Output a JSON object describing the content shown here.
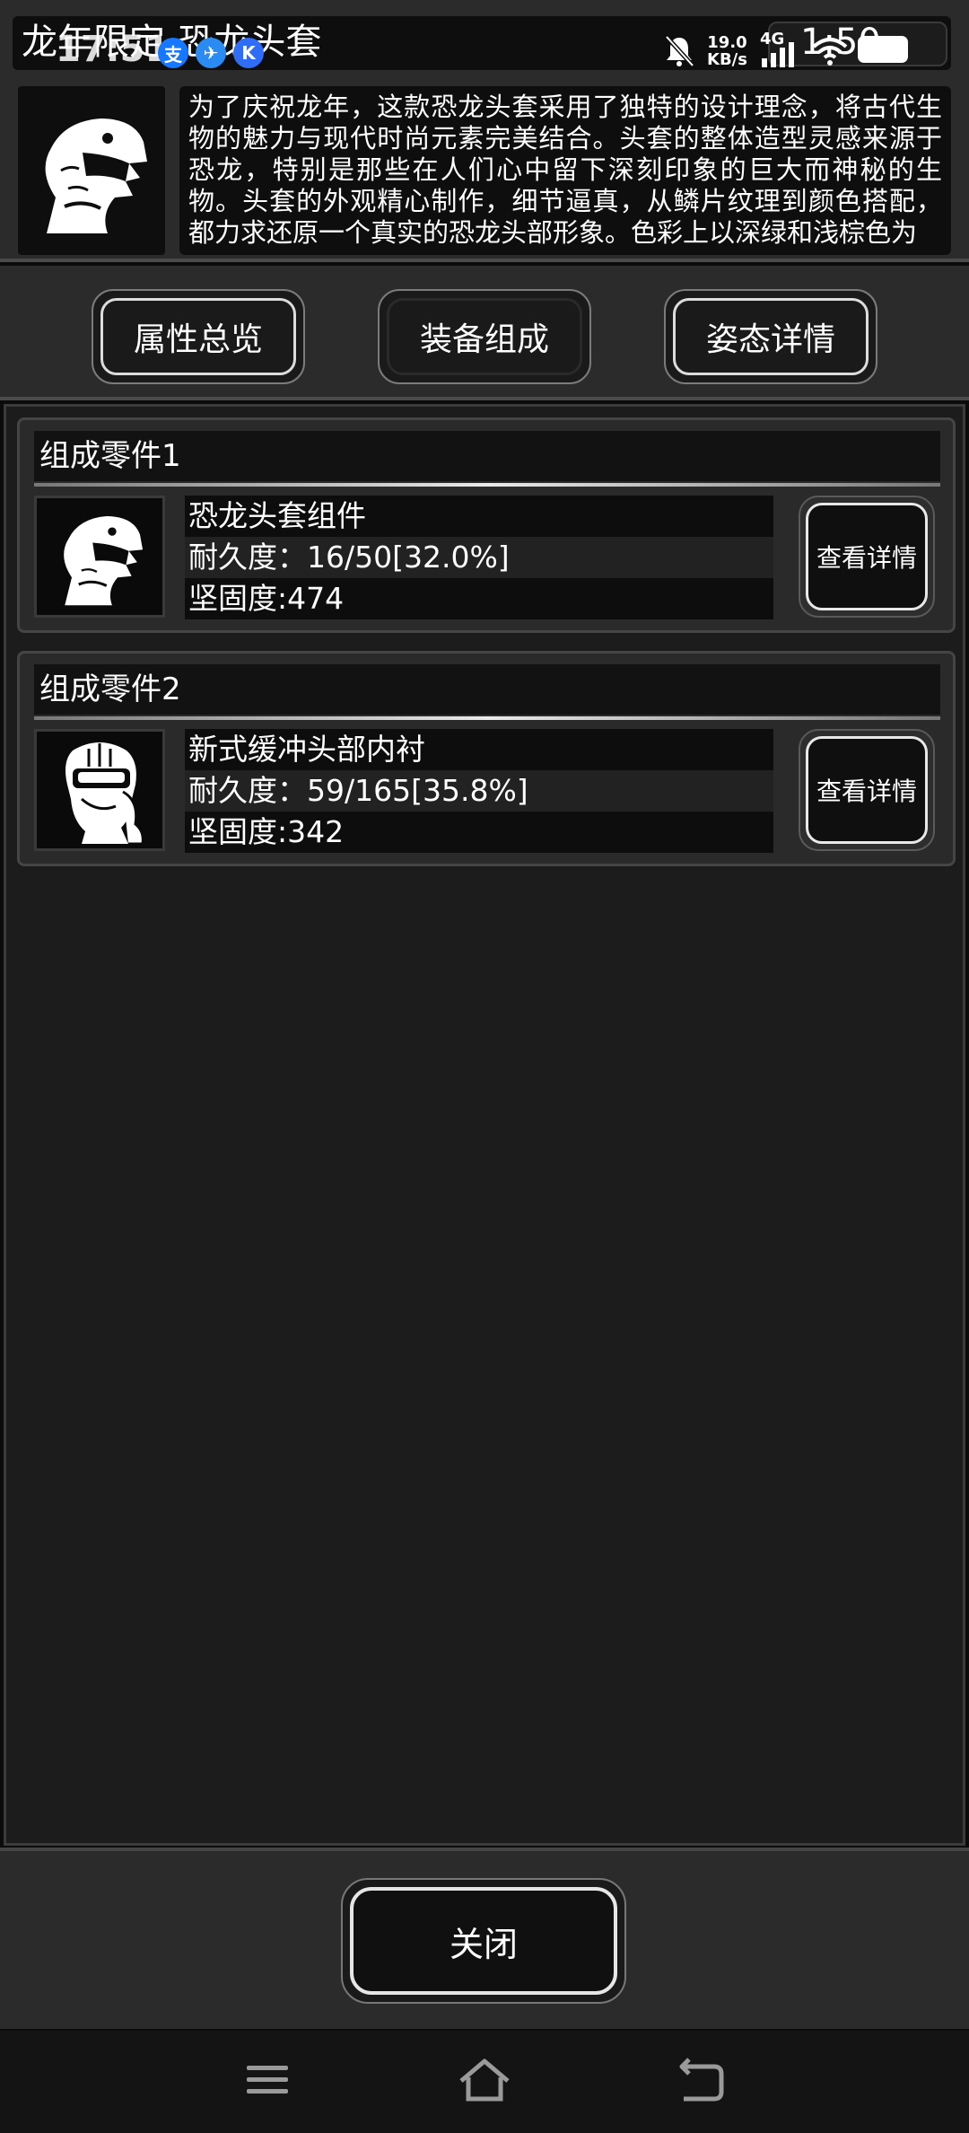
{
  "window": {
    "title": "龙年限定-恐龙头套"
  },
  "status_bar": {
    "time": "17:51",
    "apps": [
      {
        "icon": "alipay-icon",
        "label": "支",
        "color": "#1677ff"
      },
      {
        "icon": "feather-app-icon",
        "label": "✈",
        "color": "#2a8bf2"
      },
      {
        "icon": "k-app-icon",
        "label": "K",
        "color": "#2f6df6"
      }
    ],
    "net_speed_value": "19.0",
    "net_speed_unit": "KB/s",
    "network": "4G",
    "battery_text": "1:50"
  },
  "item": {
    "description": "为了庆祝龙年，这款恐龙头套采用了独特的设计理念，将古代生物的魅力与现代时尚元素完美结合。头套的整体造型灵感来源于恐龙，特别是那些在人们心中留下深刻印象的巨大而神秘的生物。头套的外观精心制作，细节逼真，从鳞片纹理到颜色搭配，都力求还原一个真实的恐龙头部形象。色彩上以深绿和浅棕色为"
  },
  "tabs": [
    {
      "label": "属性总览",
      "active": false
    },
    {
      "label": "装备组成",
      "active": true
    },
    {
      "label": "姿态详情",
      "active": false
    }
  ],
  "parts": [
    {
      "header": "组成零件1",
      "name": "恐龙头套组件",
      "durability": "耐久度：16/50[32.0%]",
      "durability_fraction": 0.32,
      "hardness": "坚固度:474",
      "icon": "dinosaur-head-icon",
      "button": "查看详情"
    },
    {
      "header": "组成零件2",
      "name": "新式缓冲头部内衬",
      "durability": "耐久度：59/165[35.8%]",
      "durability_fraction": 0.358,
      "hardness": "坚固度:342",
      "icon": "helmet-liner-icon",
      "button": "查看详情"
    }
  ],
  "footer": {
    "close_label": "关闭"
  },
  "navbar": {
    "items": [
      "menu-icon",
      "home-icon",
      "back-icon"
    ]
  }
}
